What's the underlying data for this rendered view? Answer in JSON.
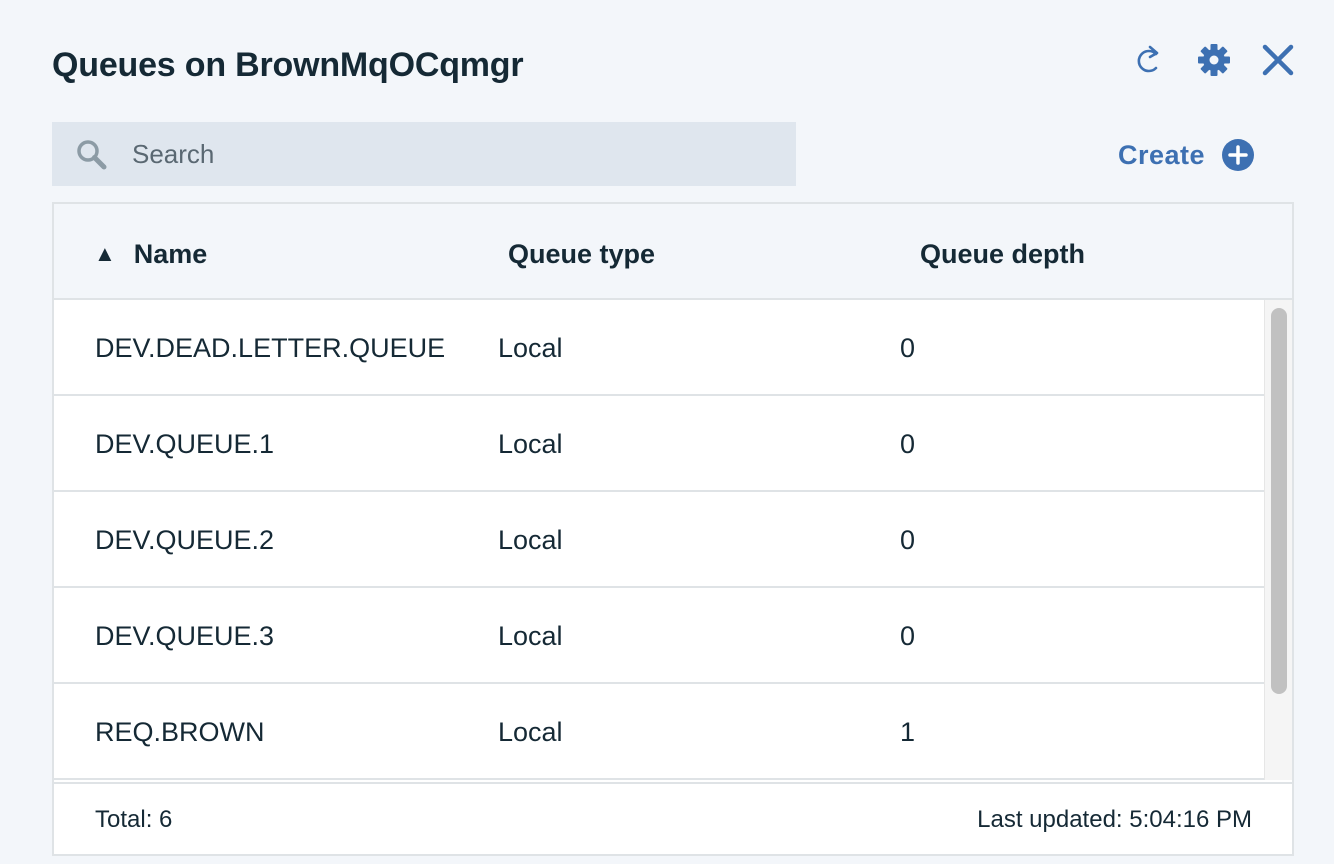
{
  "header": {
    "title": "Queues on BrownMqOCqmgr",
    "icons": [
      "refresh-icon",
      "gear-icon",
      "close-icon"
    ],
    "accent_color": "#3d70b2"
  },
  "search": {
    "placeholder": "Search",
    "value": ""
  },
  "create": {
    "label": "Create",
    "icon": "plus-circle-icon"
  },
  "table": {
    "sort_indicator": "▲",
    "columns": [
      "Name",
      "Queue type",
      "Queue depth"
    ],
    "rows": [
      {
        "name": "DEV.DEAD.LETTER.QUEUE",
        "type": "Local",
        "depth": "0"
      },
      {
        "name": "DEV.QUEUE.1",
        "type": "Local",
        "depth": "0"
      },
      {
        "name": "DEV.QUEUE.2",
        "type": "Local",
        "depth": "0"
      },
      {
        "name": "DEV.QUEUE.3",
        "type": "Local",
        "depth": "0"
      },
      {
        "name": "REQ.BROWN",
        "type": "Local",
        "depth": "1"
      }
    ]
  },
  "footer": {
    "total": "Total: 6",
    "last_updated": "Last updated: 5:04:16 PM"
  }
}
